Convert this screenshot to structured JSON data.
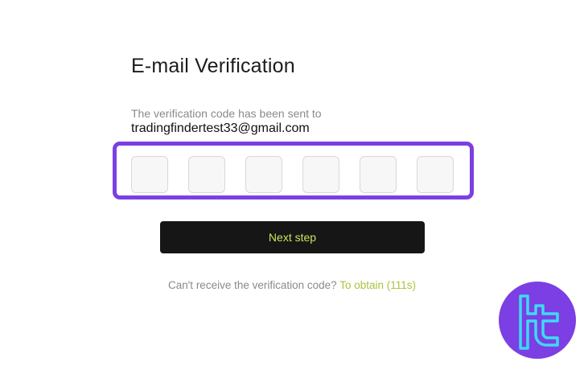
{
  "page": {
    "title": "E-mail Verification",
    "sent_label": "The verification code has been sent to",
    "email": "tradingfindertest33@gmail.com"
  },
  "code_input": {
    "digits": [
      "",
      "",
      "",
      "",
      "",
      ""
    ]
  },
  "next_button": {
    "label": "Next step"
  },
  "help": {
    "question": "Can't receive the verification code?",
    "obtain_label": "To obtain",
    "countdown": "(111s)"
  },
  "logo": {
    "icon": "tradingfinder-logo-icon"
  },
  "colors": {
    "accent_purple": "#7b3fe4",
    "button_bg": "#161616",
    "button_text": "#c7e55b",
    "link_green": "#a7c43d",
    "logo_cyan": "#3fd9f5"
  }
}
